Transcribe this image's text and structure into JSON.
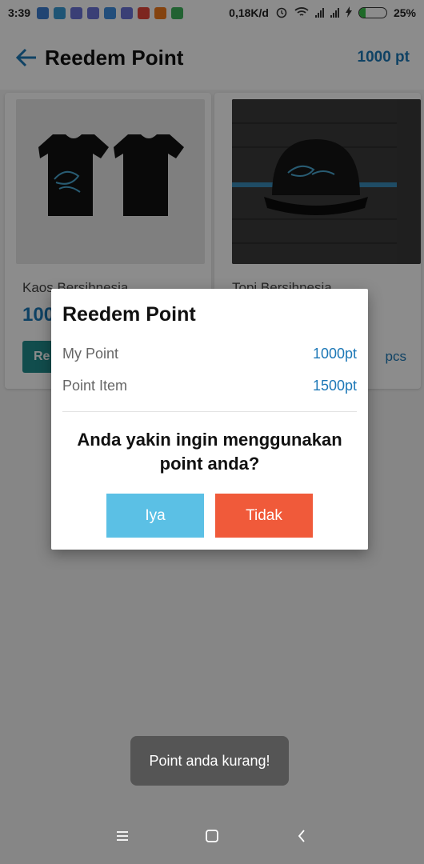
{
  "status": {
    "time": "3:39",
    "network_speed": "0,18K/d",
    "battery_text": "25%",
    "battery_level": 0.25,
    "notification_icons": [
      "sensor-icon",
      "clock-icon",
      "discord-icon",
      "discord-icon",
      "play-store-icon",
      "discord-icon",
      "chrome-icon",
      "camera-app-icon",
      "messaging-icon"
    ]
  },
  "appbar": {
    "title": "Reedem Point",
    "points": "1000 pt"
  },
  "products": [
    {
      "name": "Kaos Bersihnesia",
      "price": "100",
      "button": "Re",
      "stock": ""
    },
    {
      "name": "Topi Bersihnesia",
      "price": "",
      "button": "",
      "stock": "pcs"
    }
  ],
  "dialog": {
    "title": "Reedem Point",
    "my_point_label": "My Point",
    "my_point_value": "1000pt",
    "item_point_label": "Point Item",
    "item_point_value": "1500pt",
    "question": "Anda yakin ingin menggunakan point anda?",
    "yes_label": "Iya",
    "no_label": "Tidak"
  },
  "toast": {
    "message": "Point anda kurang!"
  },
  "colors": {
    "accent": "#1d78b7",
    "yes": "#5bc0e5",
    "no": "#f05a3a",
    "redeem_button": "#1f8c8c"
  }
}
